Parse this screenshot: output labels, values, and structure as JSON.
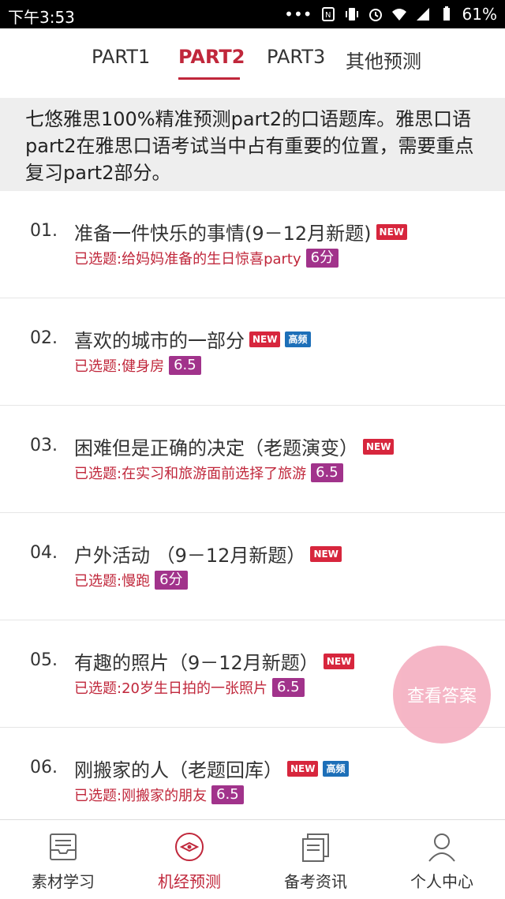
{
  "status_bar": {
    "time": "下午3:53",
    "battery": "61%"
  },
  "tabs": [
    {
      "label": "PART1"
    },
    {
      "label": "PART2"
    },
    {
      "label": "PART3"
    },
    {
      "label": "其他预测"
    }
  ],
  "intro": "七悠雅思100%精准预测part2的口语题库。雅思口语part2在雅思口语考试当中占有重要的位置，需要重点复习part2部分。",
  "items": [
    {
      "num": "01.",
      "title": "准备一件快乐的事情(9－12月新题)",
      "badges": [
        "NEW"
      ],
      "selected": "已选题:给妈妈准备的生日惊喜party",
      "score": "6分"
    },
    {
      "num": "02.",
      "title": "喜欢的城市的一部分",
      "badges": [
        "NEW",
        "高频"
      ],
      "selected": "已选题:健身房",
      "score": "6.5"
    },
    {
      "num": "03.",
      "title": "困难但是正确的决定（老题演变）",
      "badges": [
        "NEW"
      ],
      "selected": "已选题:在实习和旅游面前选择了旅游",
      "score": "6.5"
    },
    {
      "num": "04.",
      "title": "户外活动 （9－12月新题）",
      "badges": [
        "NEW"
      ],
      "selected": "已选题:慢跑",
      "score": "6分"
    },
    {
      "num": "05.",
      "title": "有趣的照片（9－12月新题）",
      "badges": [
        "NEW"
      ],
      "selected": "已选题:20岁生日拍的一张照片",
      "score": "6.5"
    },
    {
      "num": "06.",
      "title": "刚搬家的人（老题回库）",
      "badges": [
        "NEW",
        "高频"
      ],
      "selected": "已选题:刚搬家的朋友",
      "score": "6.5"
    }
  ],
  "fab_label": "查看答案",
  "bottom_nav": [
    {
      "label": "素材学习",
      "icon": "inbox-icon"
    },
    {
      "label": "机经预测",
      "icon": "compass-icon"
    },
    {
      "label": "备考资讯",
      "icon": "news-icon"
    },
    {
      "label": "个人中心",
      "icon": "person-icon"
    }
  ],
  "colors": {
    "accent": "#c0273b",
    "score_bg": "#a1338b",
    "new_badge": "#d7263d",
    "hot_badge": "#1d6fb8"
  }
}
